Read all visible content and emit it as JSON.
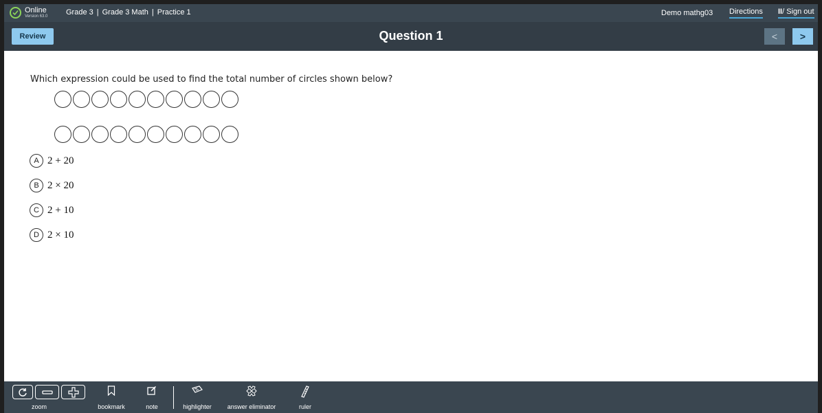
{
  "status": {
    "label": "Online",
    "version": "Version 63.0",
    "color": "#8cd35a"
  },
  "breadcrumb": {
    "grade": "Grade 3",
    "subject": "Grade 3 Math",
    "test": "Practice 1"
  },
  "user": {
    "name": "Demo mathg03"
  },
  "header_links": {
    "directions": "Directions",
    "signout_pause": "II",
    "signout": "/ Sign out"
  },
  "question_bar": {
    "review": "Review",
    "title": "Question 1",
    "prev": "<",
    "next": ">"
  },
  "question": {
    "prompt": "Which expression could be used to find the total number of circles shown below?",
    "rows": 2,
    "circles_per_row": 10,
    "choices": [
      {
        "letter": "A",
        "text": "2 + 20"
      },
      {
        "letter": "B",
        "text": "2 × 20"
      },
      {
        "letter": "C",
        "text": "2 + 10"
      },
      {
        "letter": "D",
        "text": "2 × 10"
      }
    ]
  },
  "toolbar": {
    "zoom": "zoom",
    "bookmark": "bookmark",
    "note": "note",
    "highlighter": "highlighter",
    "answer_eliminator": "answer eliminator",
    "ruler": "ruler"
  },
  "colors": {
    "topbar": "#3a4650",
    "qbar": "#333d46",
    "accent": "#8ec9ee",
    "link_underline": "#4aa8d8"
  }
}
